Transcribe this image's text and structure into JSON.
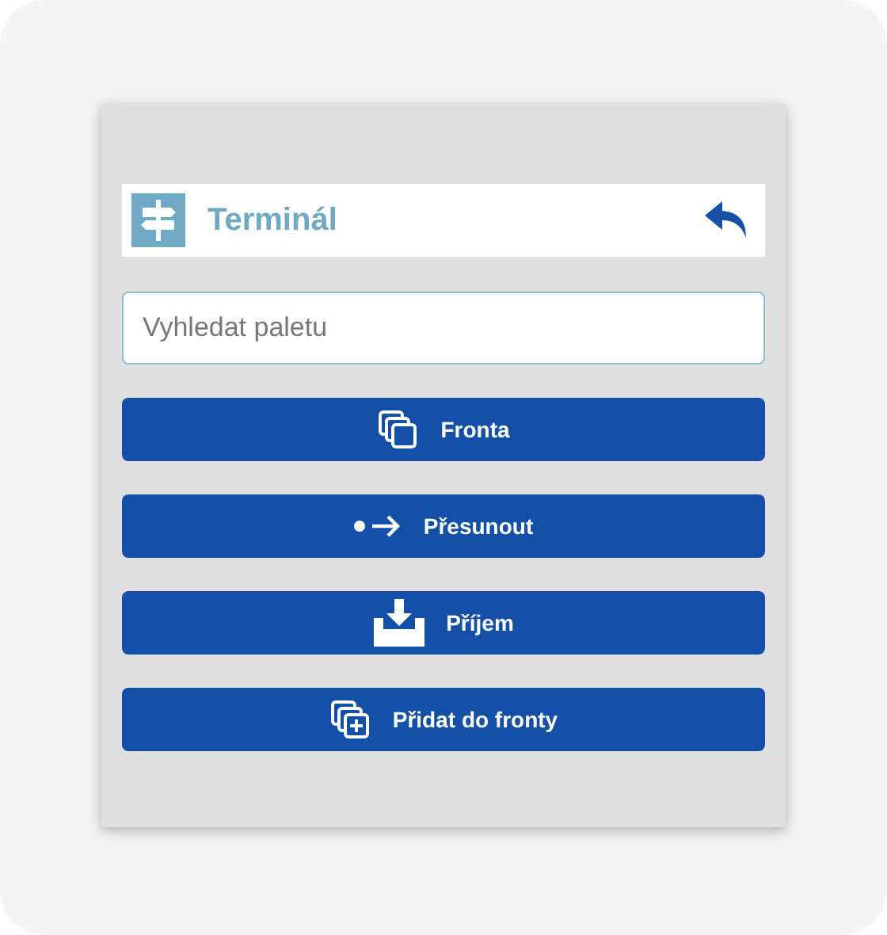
{
  "header": {
    "title": "Terminál"
  },
  "search": {
    "placeholder": "Vyhledat paletu"
  },
  "buttons": [
    {
      "label": "Fronta",
      "kind": "queue"
    },
    {
      "label": "Přesunout",
      "kind": "move"
    },
    {
      "label": "Příjem",
      "kind": "receive"
    },
    {
      "label": "Přidat do fronty",
      "kind": "add"
    }
  ]
}
